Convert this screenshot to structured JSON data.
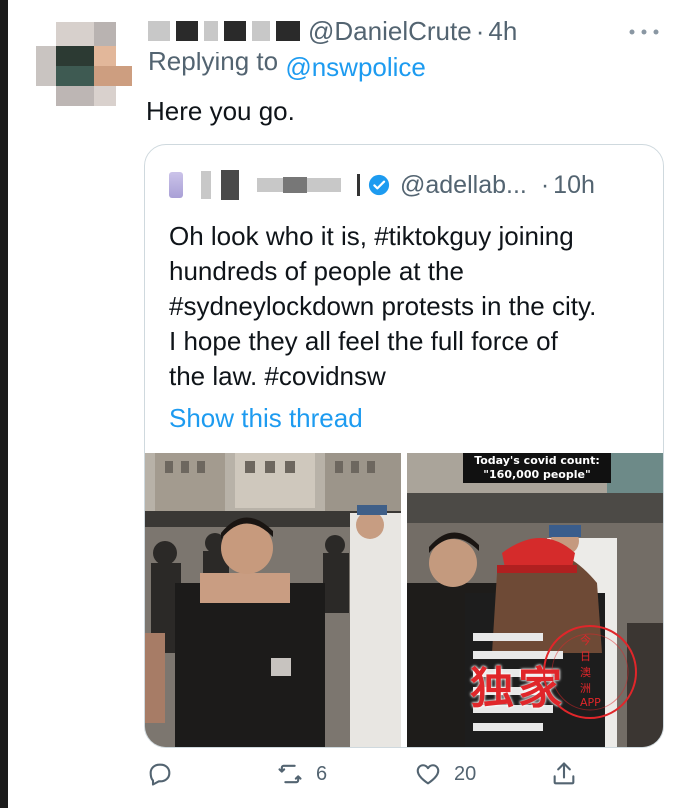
{
  "tweet": {
    "handle": "@DanielCrute",
    "time_sep": "·",
    "time": "4h",
    "replying_prefix": "Replying to",
    "replying_handle": "@nswpolice",
    "text": "Here you go.",
    "more_icon": "ellipsis-icon"
  },
  "quote": {
    "handle": "@adellab...",
    "time_sep": "·",
    "time": "10h",
    "lines": [
      "Oh look who it is, #tiktokguy joining",
      "hundreds of people at the",
      "#sydneylockdown protests in the city.",
      "I hope they all feel the full force of",
      "the law. #covidnsw"
    ],
    "show_thread": "Show this thread",
    "photo_caption_1": "Today's covid count:",
    "photo_caption_2": "\"160,000 people\""
  },
  "actions": {
    "reply_icon": "reply-icon",
    "retweet_icon": "retweet-icon",
    "retweet_count": "6",
    "like_icon": "heart-icon",
    "like_count": "20",
    "share_icon": "share-icon"
  },
  "watermark": {
    "main": "独家",
    "sub": "今日澳洲APP"
  },
  "colors": {
    "accent": "#1d9bf0",
    "secondary_text": "#536471",
    "border": "#cfd9de"
  }
}
